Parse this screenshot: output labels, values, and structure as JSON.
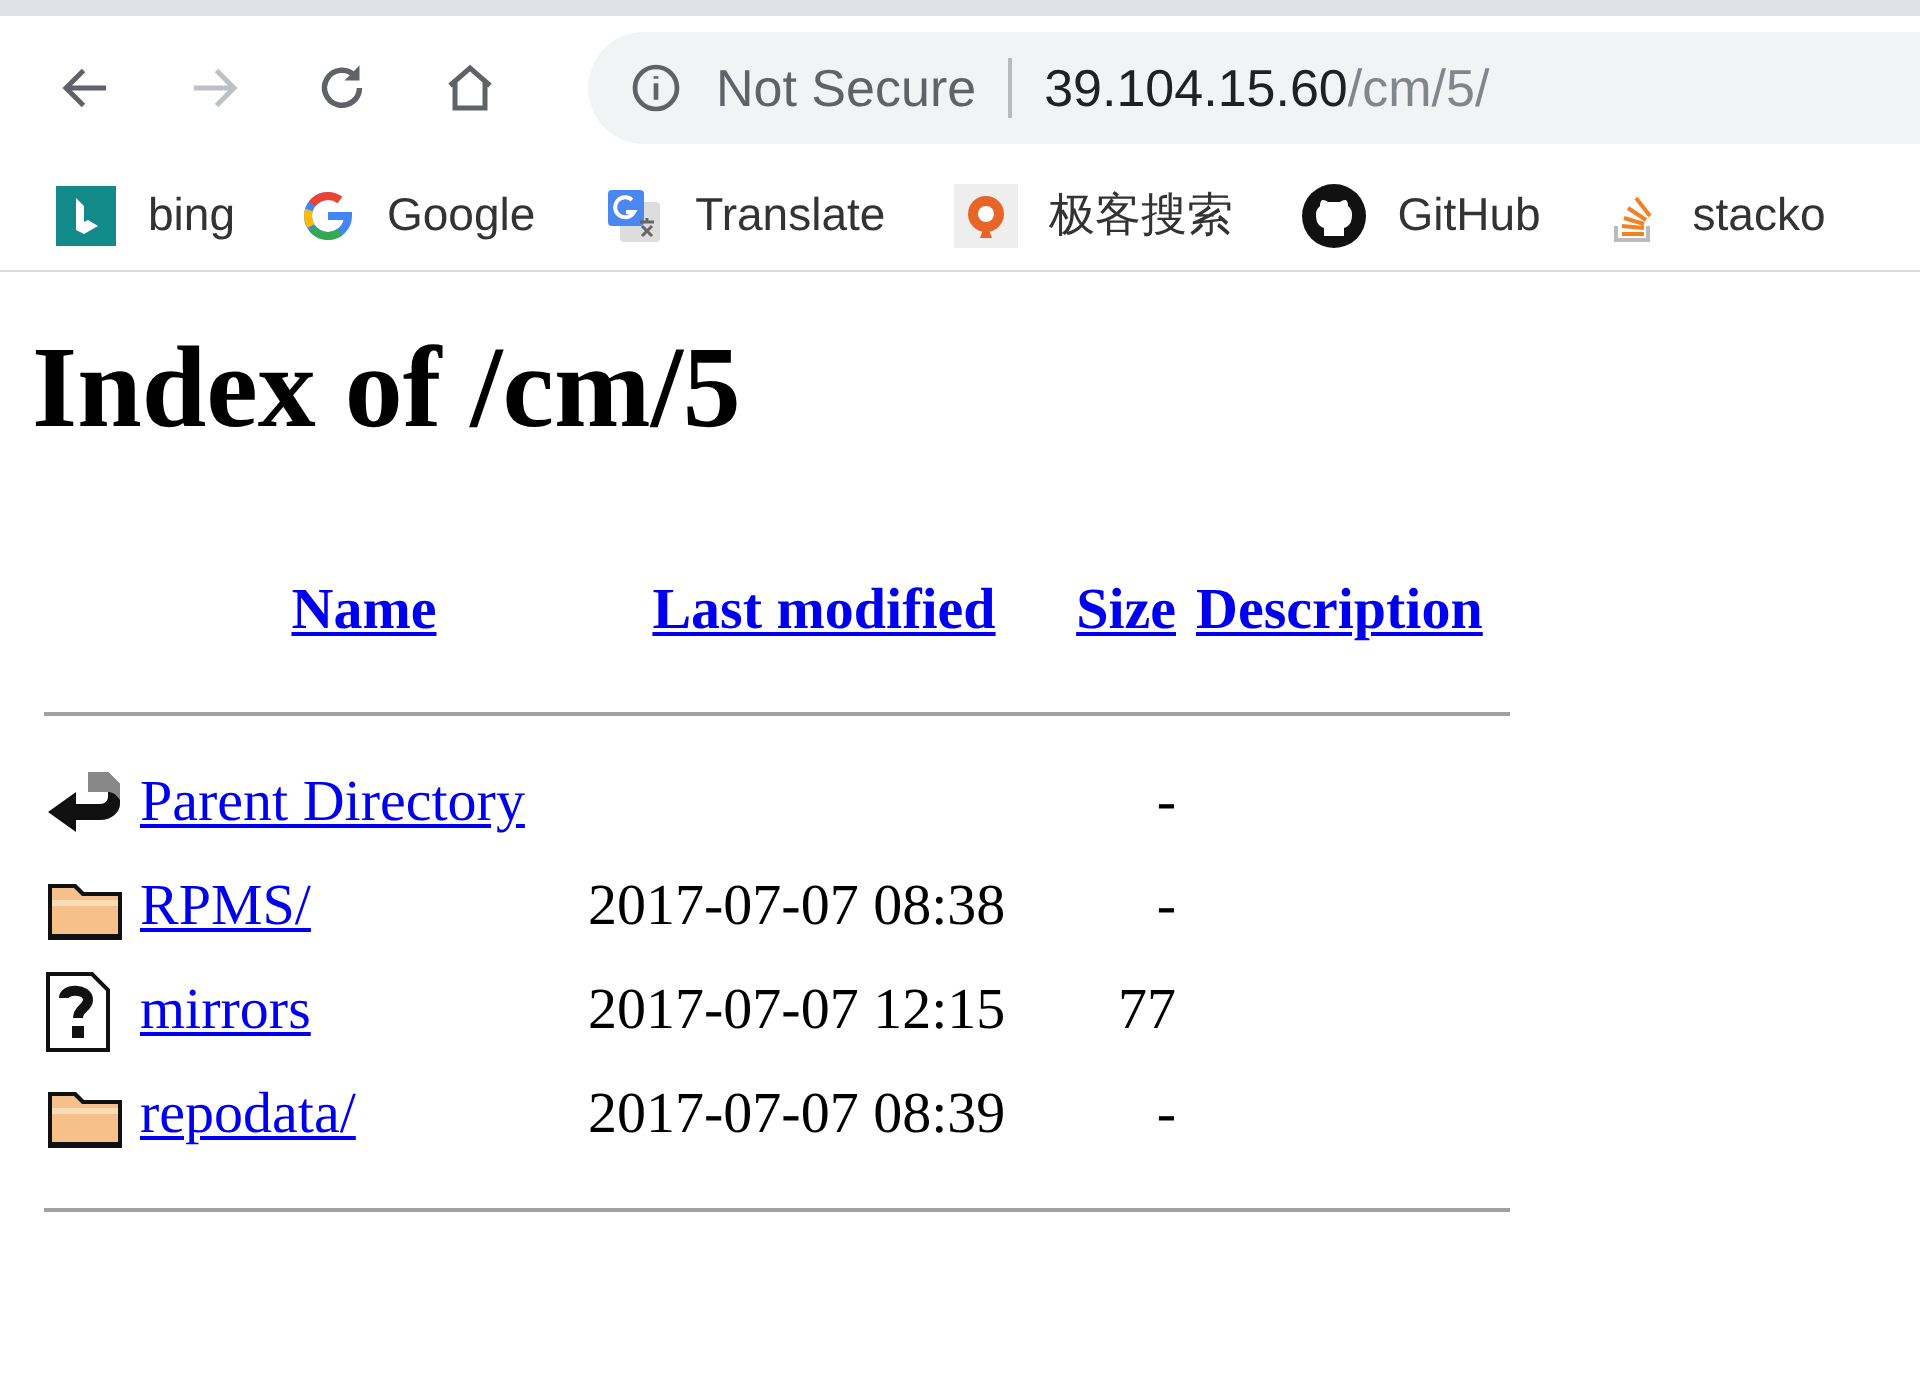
{
  "address_bar": {
    "security": "Not Secure",
    "host": "39.104.15.60",
    "path": "/cm/5/"
  },
  "bookmarks": [
    {
      "label": "bing",
      "kind": "bing"
    },
    {
      "label": "Google",
      "kind": "google"
    },
    {
      "label": "Translate",
      "kind": "translate"
    },
    {
      "label": "极客搜索",
      "kind": "geek"
    },
    {
      "label": "GitHub",
      "kind": "github"
    },
    {
      "label": "stacko",
      "kind": "stack"
    }
  ],
  "heading": "Index of /cm/5",
  "table": {
    "columns": [
      "Name",
      "Last modified",
      "Size",
      "Description"
    ],
    "rows": [
      {
        "kind": "parent",
        "name": "Parent Directory",
        "size": "-"
      },
      {
        "kind": "folder",
        "name": "RPMS/",
        "modified": "2017-07-07 08:38",
        "size": "-"
      },
      {
        "kind": "unknown",
        "name": "mirrors",
        "modified": "2017-07-07 12:15",
        "size": "77"
      },
      {
        "kind": "folder",
        "name": "repodata/",
        "modified": "2017-07-07 08:39",
        "size": "-"
      }
    ]
  }
}
